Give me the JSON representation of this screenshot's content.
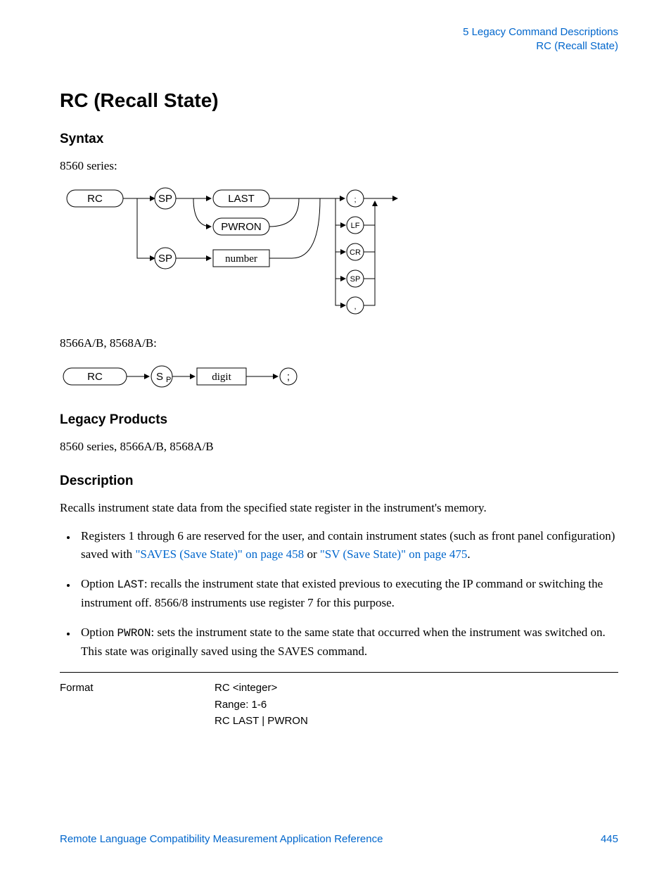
{
  "header": {
    "chapter": "5  Legacy Command Descriptions",
    "section": "RC (Recall State)"
  },
  "title": "RC (Recall State)",
  "syntax": {
    "heading": "Syntax",
    "series1_label": "8560 series:",
    "series2_label": "8566A/B, 8568A/B:",
    "d1": {
      "rc": "RC",
      "sp1": "SP",
      "last": "LAST",
      "pwron": "PWRON",
      "sp2": "SP",
      "number": "number",
      "t_semi": ";",
      "t_lf": "LF",
      "t_cr": "CR",
      "t_sp": "SP",
      "t_comma": ","
    },
    "d2": {
      "rc": "RC",
      "sp": "S",
      "sp_sub": "P",
      "digit": "digit",
      "semi": ";"
    }
  },
  "legacy": {
    "heading": "Legacy Products",
    "text": "8560 series, 8566A/B, 8568A/B"
  },
  "desc": {
    "heading": "Description",
    "intro": "Recalls instrument state data from the specified state register in the instrument's memory.",
    "b1_a": "Registers 1 through 6 are reserved for the user, and contain instrument states (such as front panel configuration) saved with ",
    "b1_link1": "\"SAVES (Save State)\" on page 458",
    "b1_or": " or ",
    "b1_link2": "\"SV (Save State)\" on page 475",
    "b1_end": ".",
    "b2_a": "Option ",
    "b2_code": "LAST",
    "b2_b": ": recalls the instrument state that existed previous to executing the IP command or switching the instrument off. 8566/8 instruments use register 7 for this purpose.",
    "b3_a": "Option ",
    "b3_code": "PWRON",
    "b3_b": ": sets the instrument state to the same state that occurred when the instrument was switched on. This state was originally saved using the SAVES command."
  },
  "format": {
    "label": "Format",
    "l1": "RC <integer>",
    "l2": "Range: 1-6",
    "l3": "RC LAST | PWRON"
  },
  "footer": {
    "doc": "Remote Language Compatibility Measurement Application Reference",
    "page": "445"
  }
}
